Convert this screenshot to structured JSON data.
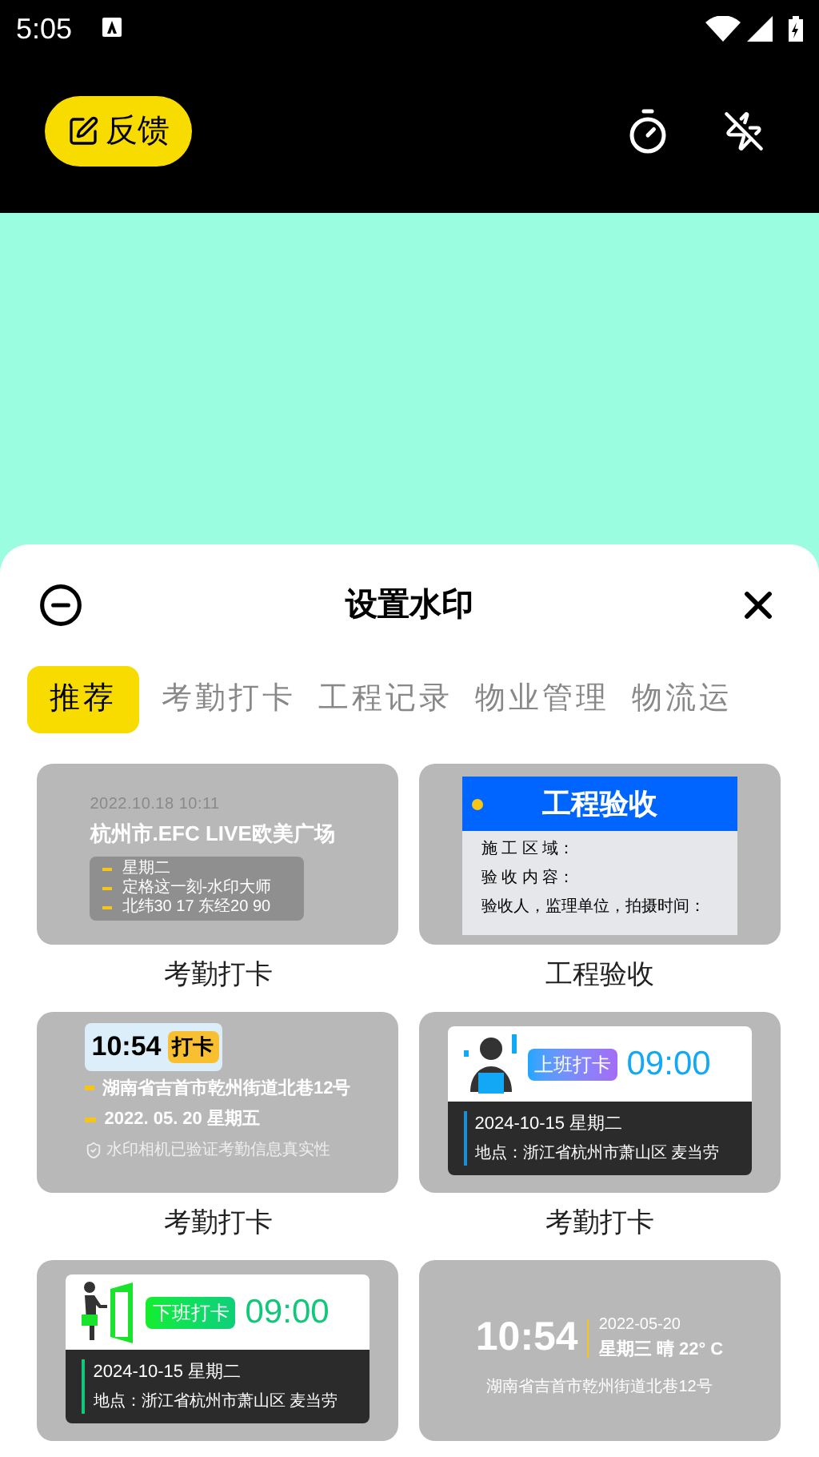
{
  "status_bar": {
    "time": "5:05"
  },
  "top_bar": {
    "feedback_button": "反馈"
  },
  "sheet": {
    "title": "设置水印",
    "tabs": [
      {
        "label": "推荐",
        "selected": true
      },
      {
        "label": "考勤打卡",
        "selected": false
      },
      {
        "label": "工程记录",
        "selected": false
      },
      {
        "label": "物业管理",
        "selected": false
      },
      {
        "label": "物流运",
        "selected": false
      }
    ],
    "templates": [
      {
        "kind": "location",
        "date": "2022.10.18 10:11",
        "place": "杭州市.EFC LIVE欧美广场",
        "lines": [
          "星期二",
          "定格这一刻-水印大师",
          "北纬30 17 东经20 90"
        ],
        "label": "考勤打卡"
      },
      {
        "kind": "inspection",
        "title": "工程验收",
        "fields": [
          "施 工 区 域：",
          "验 收 内 容：",
          "验收人，监理单位，拍摄时间："
        ],
        "label": "工程验收"
      },
      {
        "kind": "clock",
        "time": "10:54",
        "badge": "打卡",
        "lines": [
          "湖南省吉首市乾州街道北巷12号",
          "2022. 05. 20  星期五"
        ],
        "note": "水印相机已验证考勤信息真实性",
        "label": "考勤打卡"
      },
      {
        "kind": "punch_in",
        "badge": "上班打卡",
        "time": "09:00",
        "date": "2024-10-15 星期二",
        "place": "地点：浙江省杭州市萧山区 麦当劳",
        "label": "考勤打卡"
      },
      {
        "kind": "punch_out",
        "badge": "下班打卡",
        "time": "09:00",
        "date": "2024-10-15 星期二",
        "place": "地点：浙江省杭州市萧山区 麦当劳"
      },
      {
        "kind": "weather",
        "time": "10:54",
        "date": "2022-05-20",
        "weather": "星期三  晴  22° C",
        "place": "湖南省吉首市乾州街道北巷12号"
      }
    ]
  }
}
